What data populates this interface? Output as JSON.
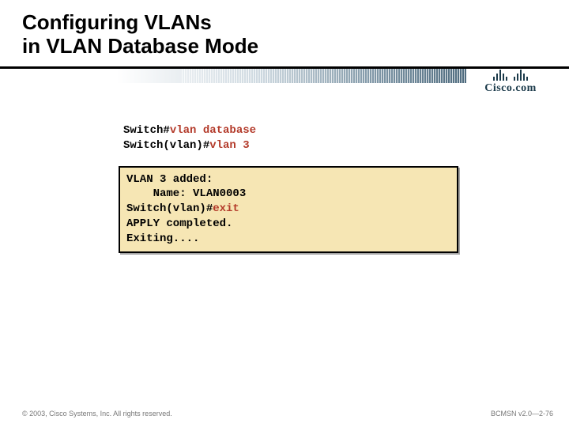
{
  "title": {
    "line1": "Configuring VLANs",
    "line2": "in VLAN Database Mode"
  },
  "logo": {
    "name": "Cisco.com"
  },
  "terminal": {
    "cmd1_prompt": "Switch#",
    "cmd1_cmd": "vlan database",
    "cmd2_prompt": "Switch(vlan)#",
    "cmd2_cmd": "vlan 3",
    "out_line1": "VLAN 3 added:",
    "out_line2": "    Name: VLAN0003",
    "out_prompt": "Switch(vlan)#",
    "out_cmd": "exit",
    "out_line4": "APPLY completed.",
    "out_line5": "Exiting...."
  },
  "footer": {
    "left": "© 2003, Cisco Systems, Inc. All rights reserved.",
    "right": "BCMSN v2.0—2-76"
  }
}
